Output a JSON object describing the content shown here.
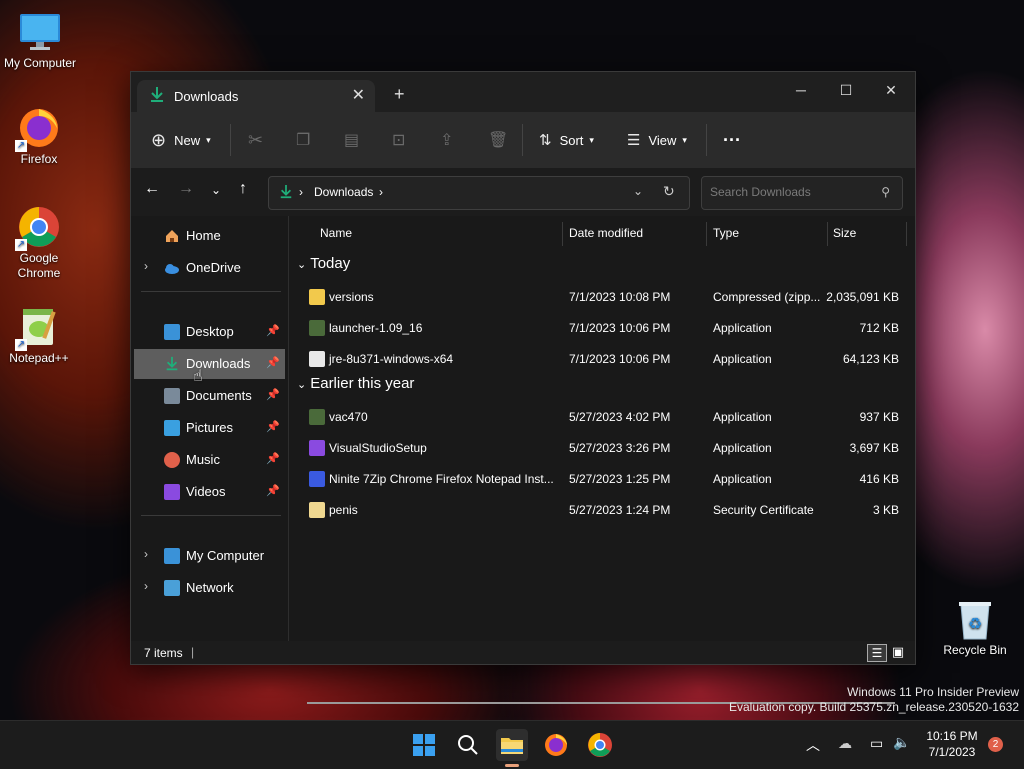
{
  "desktop": {
    "icons": [
      {
        "label": "My Computer",
        "icon": "monitor-icon"
      },
      {
        "label": "Firefox",
        "icon": "firefox-icon"
      },
      {
        "label": "Google Chrome",
        "icon": "chrome-icon"
      },
      {
        "label": "Notepad++",
        "icon": "notepadpp-icon"
      },
      {
        "label": "Recycle Bin",
        "icon": "recycle-bin-icon"
      }
    ],
    "watermark_line1": "Windows 11 Pro Insider Preview",
    "watermark_line2": "Evaluation copy. Build 25375.zn_release.230520-1632"
  },
  "window": {
    "tab_title": "Downloads",
    "new_tab_glyph": "+",
    "controls": {
      "minimize": "─",
      "maximize": "☐",
      "close": "✕"
    }
  },
  "toolbar": {
    "new_label": "New",
    "sort_label": "Sort",
    "view_label": "View",
    "more_glyph": "···"
  },
  "address": {
    "crumb": "Downloads",
    "search_placeholder": "Search Downloads"
  },
  "sidebar": {
    "home": "Home",
    "onedrive": "OneDrive",
    "desktop": "Desktop",
    "downloads": "Downloads",
    "documents": "Documents",
    "pictures": "Pictures",
    "music": "Music",
    "videos": "Videos",
    "my_computer": "My Computer",
    "network": "Network"
  },
  "columns": {
    "name": "Name",
    "date": "Date modified",
    "type": "Type",
    "size": "Size"
  },
  "groups": {
    "today": "Today",
    "earlier": "Earlier this year"
  },
  "files": [
    {
      "name": "versions",
      "date": "7/1/2023 10:08 PM",
      "type": "Compressed (zipp...",
      "size": "2,035,091 KB",
      "icon": "zip-folder-icon"
    },
    {
      "name": "launcher-1.09_16",
      "date": "7/1/2023 10:06 PM",
      "type": "Application",
      "size": "712 KB",
      "icon": "app-icon"
    },
    {
      "name": "jre-8u371-windows-x64",
      "date": "7/1/2023 10:06 PM",
      "type": "Application",
      "size": "64,123 KB",
      "icon": "java-icon"
    },
    {
      "name": "vac470",
      "date": "5/27/2023 4:02 PM",
      "type": "Application",
      "size": "937 KB",
      "icon": "app-icon"
    },
    {
      "name": "VisualStudioSetup",
      "date": "5/27/2023 3:26 PM",
      "type": "Application",
      "size": "3,697 KB",
      "icon": "visual-studio-icon"
    },
    {
      "name": "Ninite 7Zip Chrome Firefox Notepad Inst...",
      "date": "5/27/2023 1:25 PM",
      "type": "Application",
      "size": "416 KB",
      "icon": "ninite-icon"
    },
    {
      "name": "penis",
      "date": "5/27/2023 1:24 PM",
      "type": "Security Certificate",
      "size": "3 KB",
      "icon": "certificate-icon"
    }
  ],
  "status": {
    "items": "7 items",
    "cursor": "|"
  },
  "taskbar": {
    "time": "10:16 PM",
    "date": "7/1/2023",
    "notifications": "2",
    "apps": [
      "start-icon",
      "search-icon",
      "file-explorer-icon",
      "firefox-icon",
      "chrome-icon"
    ]
  },
  "colors": {
    "accent": "#1fae7a",
    "window_bg": "#191919",
    "selected": "#5e5e5e",
    "taskbar": "#1c1c1c"
  }
}
